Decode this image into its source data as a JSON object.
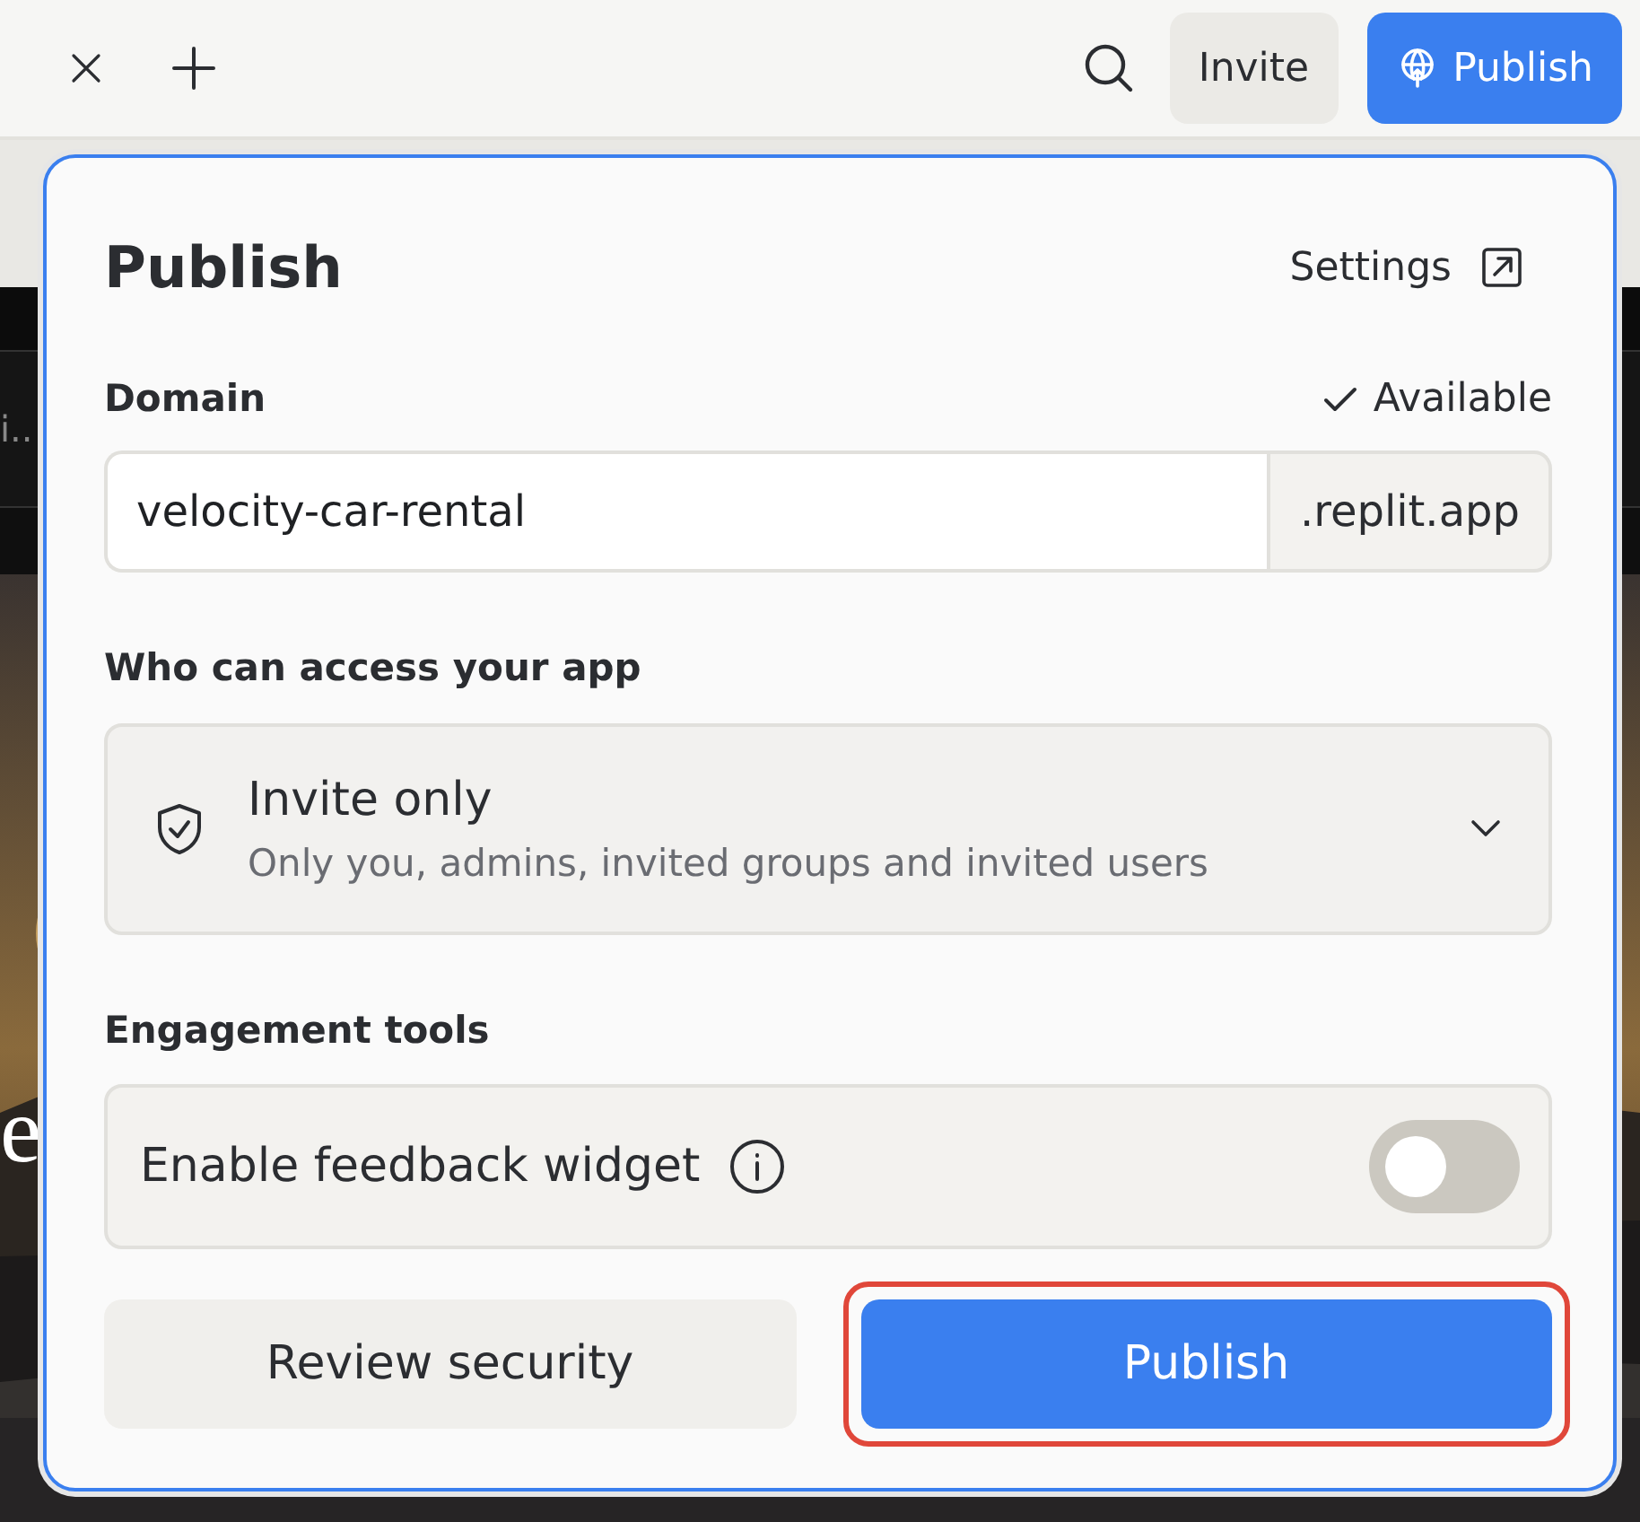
{
  "topbar": {
    "invite_button": "Invite",
    "publish_button": "Publish"
  },
  "background": {
    "row_text": "i..",
    "hero_text": "e"
  },
  "dialog": {
    "title": "Publish",
    "settings_link": "Settings",
    "domain": {
      "label": "Domain",
      "status": "Available",
      "value": "velocity-car-rental",
      "suffix": ".replit.app"
    },
    "access": {
      "label": "Who can access your app",
      "option": "Invite only",
      "description": "Only you, admins, invited groups and invited users"
    },
    "engagement": {
      "label": "Engagement tools",
      "toggle_label": "Enable feedback widget",
      "on": false
    },
    "buttons": [
      {
        "label": "Review security",
        "kind": "secondary",
        "highlighted": false
      },
      {
        "label": "Publish",
        "kind": "primary",
        "highlighted": true
      }
    ]
  }
}
